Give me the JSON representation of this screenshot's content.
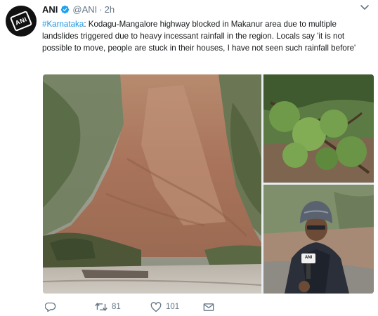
{
  "account": {
    "name": "ANI",
    "handle": "@ANI",
    "separator": "·",
    "time": "2h",
    "avatar_text": "ANI"
  },
  "tweet": {
    "hashtag": "#Karnataka",
    "body": ": Kodagu-Mangalore highway blocked in Makanur area due to multiple landslides triggered due to heavy incessant rainfall in the region. Locals say 'it is not possible to move, people are stuck in their houses, I have not seen such rainfall before'"
  },
  "media": {
    "mic_label": "ANI"
  },
  "actions": {
    "retweet_count": "81",
    "like_count": "101"
  },
  "colors": {
    "link": "#1b95e0",
    "muted": "#657786",
    "text": "#14171a"
  },
  "icons": [
    "verified-badge-icon",
    "chevron-down-icon",
    "reply-icon",
    "retweet-icon",
    "like-icon",
    "direct-message-icon"
  ]
}
